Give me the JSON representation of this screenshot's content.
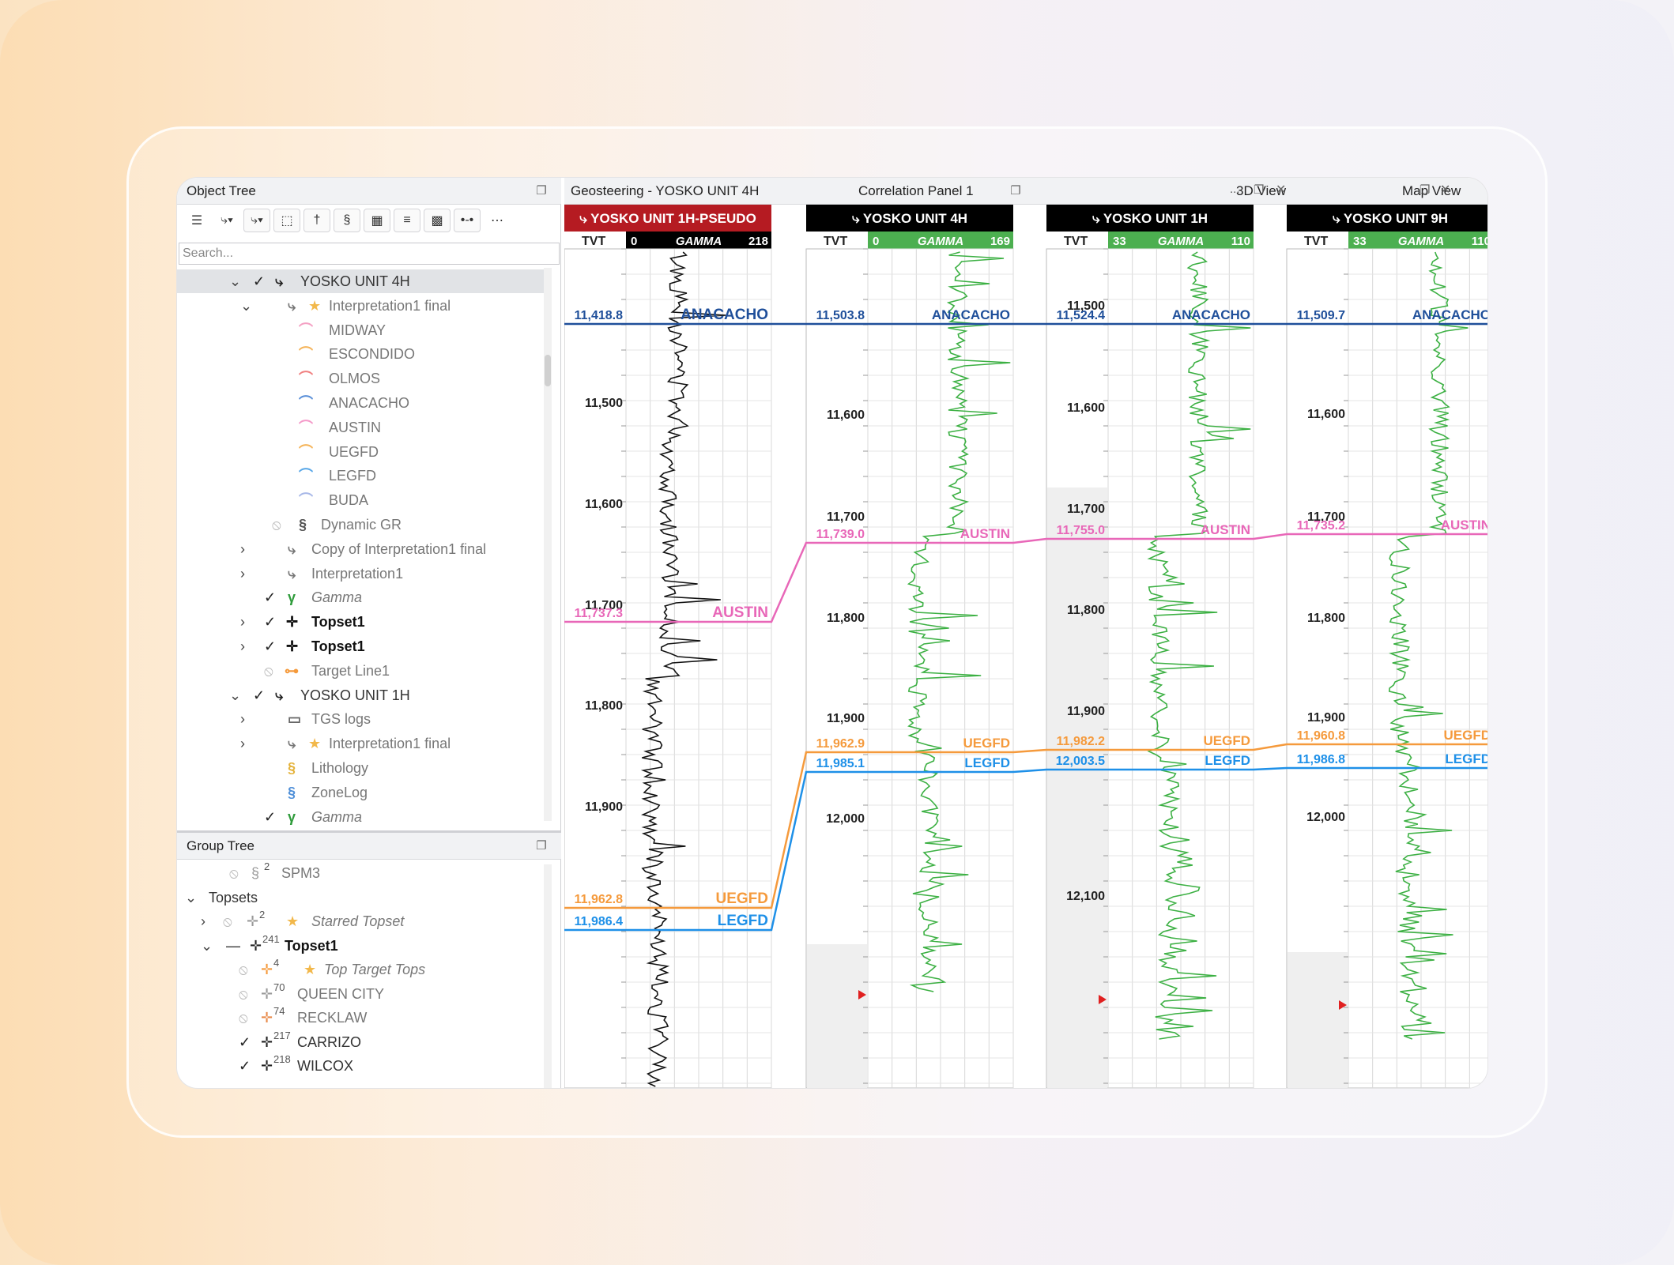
{
  "left": {
    "object_tree_title": "Object Tree",
    "search_placeholder": "Search...",
    "object_rows": [
      {
        "label": "YOSKO UNIT 4H",
        "icon": "well-icon"
      },
      {
        "label": "Interpretation1 final",
        "icon": "interpretation-icon"
      },
      {
        "label": "MIDWAY",
        "color": "#f4a0c3"
      },
      {
        "label": "ESCONDIDO",
        "color": "#f5b45a"
      },
      {
        "label": "OLMOS",
        "color": "#f08080"
      },
      {
        "label": "ANACACHO",
        "color": "#5a8fd8"
      },
      {
        "label": "AUSTIN",
        "color": "#f49ac9"
      },
      {
        "label": "UEGFD",
        "color": "#f5b45a"
      },
      {
        "label": "LEGFD",
        "color": "#5aa8e8"
      },
      {
        "label": "BUDA",
        "color": "#a8b8e8"
      },
      {
        "label": "Dynamic GR"
      },
      {
        "label": "Copy of Interpretation1 final"
      },
      {
        "label": "Interpretation1"
      },
      {
        "label": "Gamma"
      },
      {
        "label": "Topset1"
      },
      {
        "label": "Topset1"
      },
      {
        "label": "Target Line1"
      },
      {
        "label": "YOSKO UNIT 1H"
      },
      {
        "label": "TGS logs"
      },
      {
        "label": "Interpretation1 final"
      },
      {
        "label": "Lithology"
      },
      {
        "label": "ZoneLog"
      },
      {
        "label": "Gamma"
      }
    ],
    "group_tree_title": "Group Tree",
    "group_rows": [
      {
        "label": "SPM3",
        "sup": "2"
      },
      {
        "label": "Topsets"
      },
      {
        "label": "Starred Topset",
        "sup": "2"
      },
      {
        "label": "Topset1",
        "sup": "241"
      },
      {
        "label": "Top Target Tops",
        "sup": "4"
      },
      {
        "label": "QUEEN CITY",
        "sup": "70"
      },
      {
        "label": "RECKLAW",
        "sup": "74"
      },
      {
        "label": "CARRIZO",
        "sup": "217"
      },
      {
        "label": "WILCOX",
        "sup": "218"
      }
    ]
  },
  "panels": {
    "geosteering_title": "Geosteering - YOSKO UNIT 4H",
    "correlation_title": "Correlation Panel 1",
    "view3d_title": "3D View",
    "map_title": "Map View",
    "ellipsis": "..."
  },
  "tracks": [
    {
      "name": "YOSKO UNIT 1H-PSEUDO",
      "header_color": "#b51b22",
      "gamma_min": "0",
      "gamma_max": "218",
      "gamma_color": "#000000",
      "depth_labels": [
        "11,500",
        "11,600",
        "11,700",
        "11,800",
        "11,900"
      ],
      "tops": {
        "anacacho": "11,418.8",
        "austin": "11,737.3",
        "uegfd": "11,962.8",
        "legfd": "11,986.4"
      }
    },
    {
      "name": "YOSKO UNIT 4H",
      "header_color": "#000000",
      "gamma_min": "0",
      "gamma_max": "169",
      "gamma_color": "#3cb043",
      "depth_labels": [
        "11,600",
        "11,700",
        "11,800",
        "11,900",
        "12,000"
      ],
      "tops": {
        "anacacho": "11,503.8",
        "austin": "11,739.0",
        "uegfd": "11,962.9",
        "legfd": "11,985.1"
      }
    },
    {
      "name": "YOSKO UNIT 1H",
      "header_color": "#000000",
      "gamma_min": "33",
      "gamma_max": "110",
      "gamma_color": "#3cb043",
      "depth_labels": [
        "11,500",
        "11,600",
        "11,700",
        "11,800",
        "11,900",
        "12,100"
      ],
      "tops": {
        "anacacho": "11,524.4",
        "austin": "11,755.0",
        "uegfd": "11,982.2",
        "legfd": "12,003.5"
      }
    },
    {
      "name": "YOSKO UNIT 9H",
      "header_color": "#000000",
      "gamma_min": "33",
      "gamma_max": "110",
      "gamma_color": "#3cb043",
      "depth_labels": [
        "11,600",
        "11,700",
        "11,800",
        "11,900",
        "12,000"
      ],
      "tops": {
        "anacacho": "11,509.7",
        "austin": "11,735.2",
        "uegfd": "11,960.8",
        "legfd": "11,986.8"
      }
    }
  ],
  "track_labels": {
    "tvt": "TVT",
    "gamma": "GAMMA",
    "anacacho": "ANACACHO",
    "austin": "AUSTIN",
    "uegfd": "UEGFD",
    "legfd": "LEGFD"
  },
  "colors": {
    "anacacho": "#1f4f9a",
    "austin": "#e867b8",
    "uegfd": "#f59a3c",
    "legfd": "#1e90e8"
  }
}
